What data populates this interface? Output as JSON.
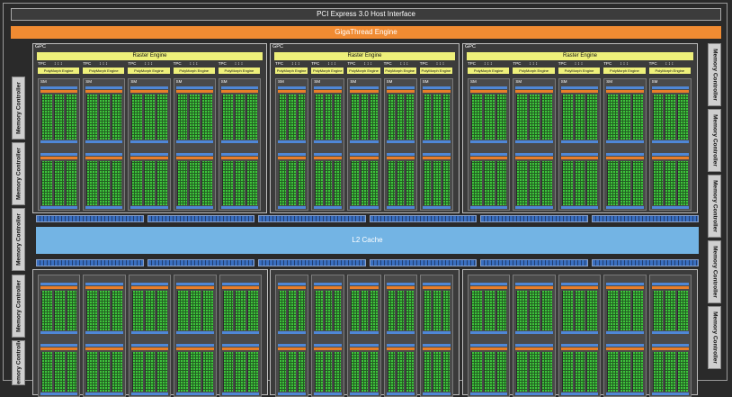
{
  "pcie_label": "PCI Express 3.0 Host Interface",
  "gigathread_label": "GigaThread Engine",
  "l2_label": "L2 Cache",
  "memory_controller_label": "Memory Controller",
  "gpc_label": "GPC",
  "raster_label": "Raster Engine",
  "tpc_label": "TPC",
  "polymorph_label": "PolyMorph Engine",
  "sm_label": "SM",
  "colors": {
    "background": "#2a2a2a",
    "gigathread": "#f08b32",
    "raster": "#eef07a",
    "l2": "#73b4e4",
    "cores": "#3ec43c",
    "cache_strip": "#4f87d6",
    "scheduler_strip": "#e87e2a"
  }
}
